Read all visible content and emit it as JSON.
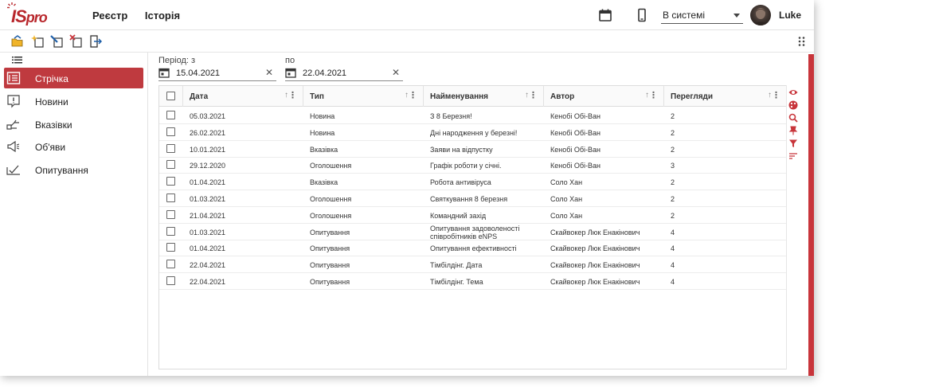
{
  "app": {
    "logo_main": "IS",
    "logo_sub": "pro",
    "nav": [
      "Реєстр",
      "Історія"
    ],
    "status": "В системі",
    "user": "Luke",
    "accent": "#bf3a3f"
  },
  "sidebar": {
    "items": [
      {
        "label": "Стрічка",
        "icon": "feed-icon",
        "active": true
      },
      {
        "label": "Новини",
        "icon": "news-icon",
        "active": false
      },
      {
        "label": "Вказівки",
        "icon": "directive-icon",
        "active": false
      },
      {
        "label": "Об'яви",
        "icon": "megaphone-icon",
        "active": false
      },
      {
        "label": "Опитування",
        "icon": "poll-icon",
        "active": false
      }
    ]
  },
  "period": {
    "from_label": "Період: з",
    "from_value": "15.04.2021",
    "to_label": "по",
    "to_value": "22.04.2021"
  },
  "table": {
    "columns": [
      "Дата",
      "Тип",
      "Найменування",
      "Автор",
      "Перегляди"
    ],
    "rows": [
      [
        "05.03.2021",
        "Новина",
        "З 8 Березня!",
        "Кенобі Обі-Ван",
        "2"
      ],
      [
        "26.02.2021",
        "Новина",
        "Дні народження у березні!",
        "Кенобі Обі-Ван",
        "2"
      ],
      [
        "10.01.2021",
        "Вказівка",
        "Заяви на відпустку",
        "Кенобі Обі-Ван",
        "2"
      ],
      [
        "29.12.2020",
        "Оголошення",
        "Графік роботи у січні.",
        "Кенобі Обі-Ван",
        "3"
      ],
      [
        "01.04.2021",
        "Вказівка",
        "Робота антивіруса",
        "Соло Хан",
        "2"
      ],
      [
        "01.03.2021",
        "Оголошення",
        "Святкування 8 березня",
        "Соло Хан",
        "2"
      ],
      [
        "21.04.2021",
        "Оголошення",
        "Командний захід",
        "Соло Хан",
        "2"
      ],
      [
        "01.03.2021",
        "Опитування",
        "Опитування задоволеності співробітників eNPS",
        "Скайвокер Люк Енакінович",
        "4"
      ],
      [
        "01.04.2021",
        "Опитування",
        "Опитування ефективності",
        "Скайвокер Люк Енакінович",
        "4"
      ],
      [
        "22.04.2021",
        "Опитування",
        "Тімбілдінг. Дата",
        "Скайвокер Люк Енакінович",
        "4"
      ],
      [
        "22.04.2021",
        "Опитування",
        "Тімбілдінг. Тема",
        "Скайвокер Люк Енакінович",
        "4"
      ]
    ]
  }
}
